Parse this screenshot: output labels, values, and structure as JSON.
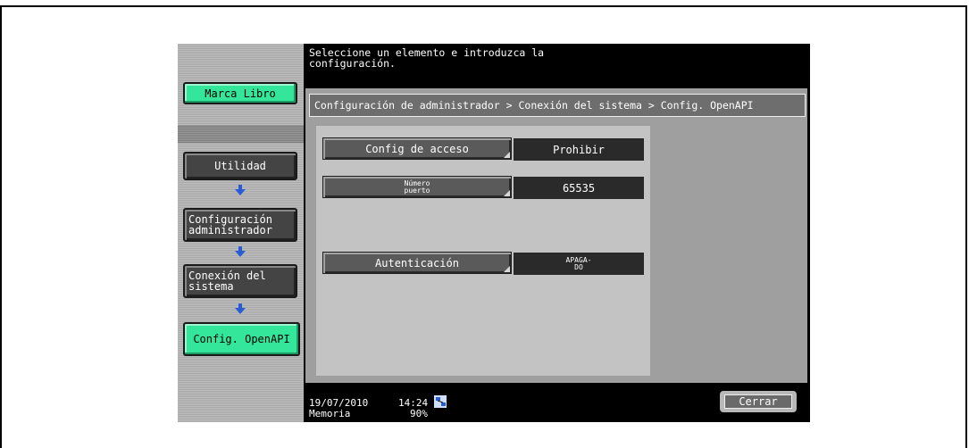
{
  "sidebar": {
    "bookmark_label": "Marca Libro",
    "nav": [
      {
        "label": "Utilidad"
      },
      {
        "label_line1": "Configuración",
        "label_line2": "administrador"
      },
      {
        "label_line1": "Conexión del",
        "label_line2": "sistema"
      },
      {
        "label": "Config. OpenAPI"
      }
    ]
  },
  "message": {
    "line1": "Seleccione un elemento e introduzca la",
    "line2": "configuración."
  },
  "breadcrumb": "Configuración de administrador > Conexión del sistema > Config. OpenAPI",
  "settings": [
    {
      "label": "Config de acceso",
      "value": "Prohibir"
    },
    {
      "label_line1": "Número",
      "label_line2": "puerto",
      "value": "65535"
    },
    {
      "label": "Autenticación",
      "value_line1": "APAGA-",
      "value_line2": "DO"
    }
  ],
  "status": {
    "date": "19/07/2010",
    "time": "14:24",
    "memory_label": "Memoria",
    "memory_value": "90%"
  },
  "close_label": "Cerrar",
  "icons": {
    "arrow": "arrow-down-icon",
    "network": "network-icon"
  },
  "colors": {
    "accent_green": "#33e69a",
    "arrow_blue": "#2a5bd7"
  }
}
